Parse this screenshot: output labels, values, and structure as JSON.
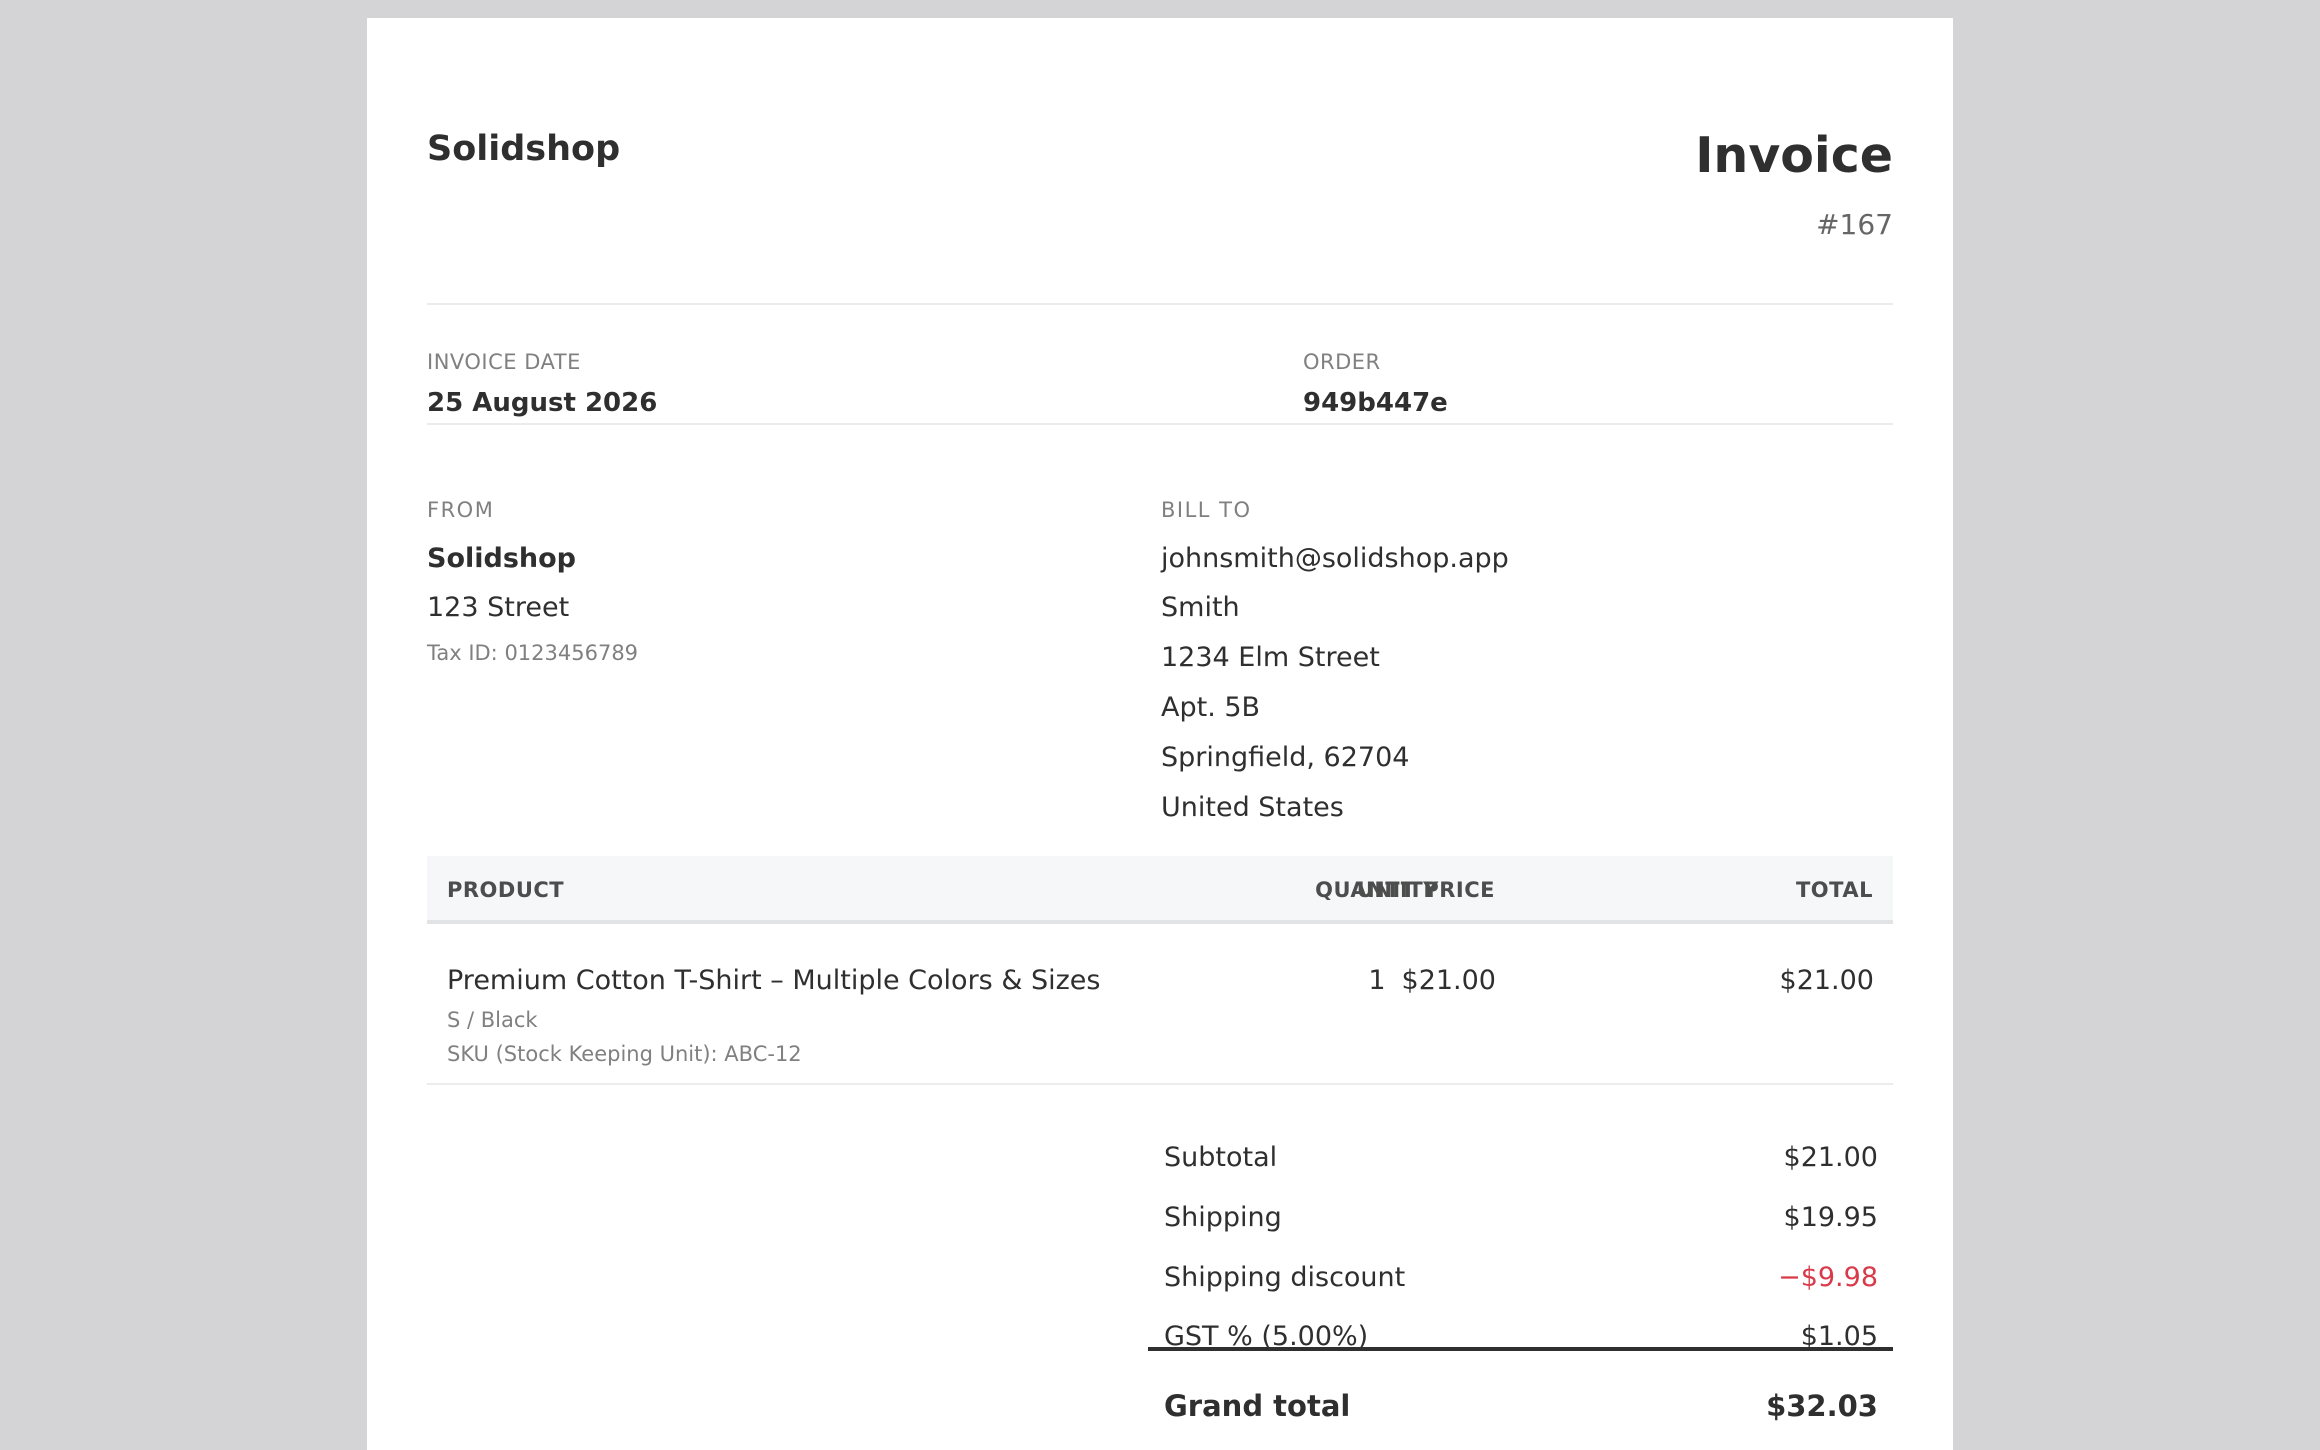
{
  "header": {
    "brand": "Solidshop",
    "title": "Invoice",
    "number": "#167"
  },
  "meta": {
    "date_label": "INVOICE DATE",
    "date_value": "25 August 2026",
    "order_label": "ORDER",
    "order_value": "949b447e"
  },
  "from": {
    "label": "FROM",
    "name": "Solidshop",
    "street": "123 Street",
    "tax_id": "Tax ID: 0123456789"
  },
  "bill_to": {
    "label": "BILL TO",
    "lines": [
      "johnsmith@solidshop.app",
      "Smith",
      "1234 Elm Street",
      "Apt. 5B",
      "Springfield, 62704",
      "United States"
    ]
  },
  "table": {
    "headers": {
      "product": "PRODUCT",
      "unit_price": "UNIT PRICE",
      "quantity": "QUANTITY",
      "total": "TOTAL"
    },
    "rows": [
      {
        "product": "Premium Cotton T-Shirt – Multiple Colors & Sizes",
        "variant": "S / Black",
        "sku": "SKU (Stock Keeping Unit): ABC-12",
        "unit_price": "$21.00",
        "quantity": "1",
        "total": "$21.00"
      }
    ]
  },
  "totals": {
    "subtotal_label": "Subtotal",
    "subtotal_value": "$21.00",
    "shipping_label": "Shipping",
    "shipping_value": "$19.95",
    "discount_label": "Shipping discount",
    "discount_value": "−$9.98",
    "tax_label": "GST % (5.00%)",
    "tax_value": "$1.05",
    "grand_label": "Grand total",
    "grand_value": "$32.03"
  },
  "colors": {
    "background": "#d4d4d6",
    "paper": "#ffffff",
    "text": "#2f2f2f",
    "muted": "#808080",
    "negative": "#d93a4a"
  }
}
